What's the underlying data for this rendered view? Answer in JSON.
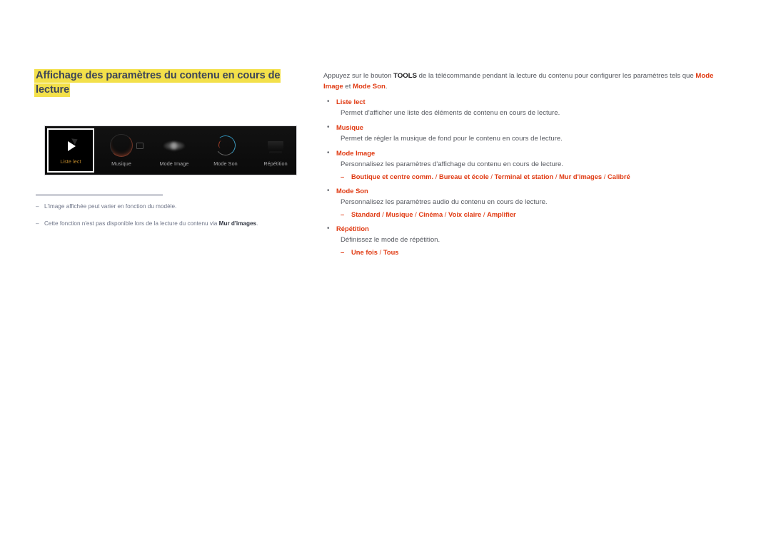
{
  "page": {
    "title_line1": "Affichage des paramètres du contenu en cours de",
    "title_line2": "lecture",
    "title_highlight_color": "#f3e04a",
    "title_text_color": "#3d4558",
    "accent_red": "#e03a12",
    "osd_label_amber": "#c08a2b"
  },
  "device_osd": {
    "items": [
      {
        "label": "Liste lect",
        "icon": "play-triangle-icon",
        "selected": true
      },
      {
        "label": "Musique",
        "icon": "music-knob-icon",
        "selected": false
      },
      {
        "label": "Mode Image",
        "icon": "picture-mode-icon",
        "selected": false
      },
      {
        "label": "Mode Son",
        "icon": "sound-dial-icon",
        "selected": false
      },
      {
        "label": "Répétition",
        "icon": "repeat-chip-icon",
        "selected": false
      }
    ]
  },
  "notes": [
    {
      "dash": "–",
      "text": "L'image affichée peut varier en fonction du modèle.",
      "bold_tail": ""
    },
    {
      "dash": "–",
      "text": "Cette fonction n'est pas disponible lors de la lecture du contenu via ",
      "bold_tail": "Mur d'images",
      "text_after": "."
    }
  ],
  "content": {
    "lead": {
      "part1": "Appuyez sur le bouton ",
      "tools": "TOOLS",
      "part2": " de la télécommande pendant la lecture du contenu pour configurer les paramètres tels que ",
      "red1": "Mode Image",
      "part3": " et ",
      "red2": "Mode Son",
      "part4": "."
    },
    "bullet_char": "•",
    "dash_char": "–",
    "items": [
      {
        "label": "Liste lect",
        "desc": "Permet d'afficher une liste des éléments de contenu en cours de lecture.",
        "options": []
      },
      {
        "label": "Musique",
        "desc": "Permet de régler la musique de fond pour le contenu en cours de lecture.",
        "options": []
      },
      {
        "label": "Mode Image",
        "desc": "Personnalisez les paramètres d'affichage du contenu en cours de lecture.",
        "options": [
          "Boutique et centre comm.",
          "Bureau et école",
          "Terminal et station",
          "Mur d'images",
          "Calibré"
        ]
      },
      {
        "label": "Mode Son",
        "desc": "Personnalisez les paramètres audio du contenu en cours de lecture.",
        "options": [
          "Standard",
          "Musique",
          "Cinéma",
          "Voix claire",
          "Amplifier"
        ]
      },
      {
        "label": "Répétition",
        "desc": "Définissez le mode de répétition.",
        "options": [
          "Une fois",
          "Tous"
        ]
      }
    ]
  }
}
